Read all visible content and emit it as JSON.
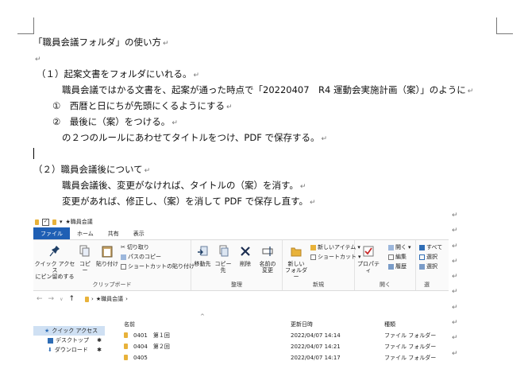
{
  "document": {
    "lines": [
      "「職員会議フォルダ」の使い方",
      "（１）起案文書をフォルダにいれる。",
      "職員会議ではかる文書を、起案が通った時点で「20220407　R4 運動会実施計画（案）」のように",
      "①　西暦と日にちが先頭にくるようにする",
      "②　最後に（案）をつける。",
      "の２つのルールにあわせてタイトルをつけ、PDF で保存する。",
      "（２）職員会議後について",
      "職員会議後、変更がなければ、タイトルの（案）を消す。",
      "変更があれば、修正し、（案）を消して PDF で保存し直す。"
    ],
    "paragraph_mark": "↵"
  },
  "explorer": {
    "title": "★職員会議",
    "tabs": [
      "ファイル",
      "ホーム",
      "共有",
      "表示"
    ],
    "ribbon": {
      "clipboard": {
        "quick_access_line1": "クイック アクセス",
        "quick_access_line2": "にピン留めする",
        "copy": "コピー",
        "paste": "貼り付け",
        "cut": "切り取り",
        "copy_path": "パスのコピー",
        "paste_shortcut": "ショートカットの貼り付け",
        "group": "クリップボード"
      },
      "organize": {
        "move_to": "移動先",
        "copy_to": "コピー先",
        "delete": "削除",
        "rename_line1": "名前の",
        "rename_line2": "変更",
        "group": "整理"
      },
      "new": {
        "new_folder_line1": "新しい",
        "new_folder_line2": "フォルダー",
        "new_item": "新しいアイテム",
        "shortcut": "ショートカット",
        "group": "新規"
      },
      "open": {
        "properties": "プロパティ",
        "open": "開く",
        "edit": "編集",
        "history": "履歴",
        "group": "開く"
      },
      "select": {
        "all": "すべて",
        "select_none": "選択",
        "invert": "選択",
        "group": "選"
      }
    },
    "address": "★職員会議",
    "nav": {
      "quick_access": "クイック アクセス",
      "desktop": "デスクトップ",
      "downloads": "ダウンロード"
    },
    "columns": {
      "name": "名前",
      "modified": "更新日時",
      "type": "種類"
    },
    "rows": [
      {
        "name": "0401　第１回",
        "modified": "2022/04/07 14:14",
        "type": "ファイル フォルダー"
      },
      {
        "name": "0404　第２回",
        "modified": "2022/04/07 14:21",
        "type": "ファイル フォルダー"
      },
      {
        "name": "0405",
        "modified": "2022/04/07 14:17",
        "type": "ファイル フォルダー"
      }
    ]
  }
}
